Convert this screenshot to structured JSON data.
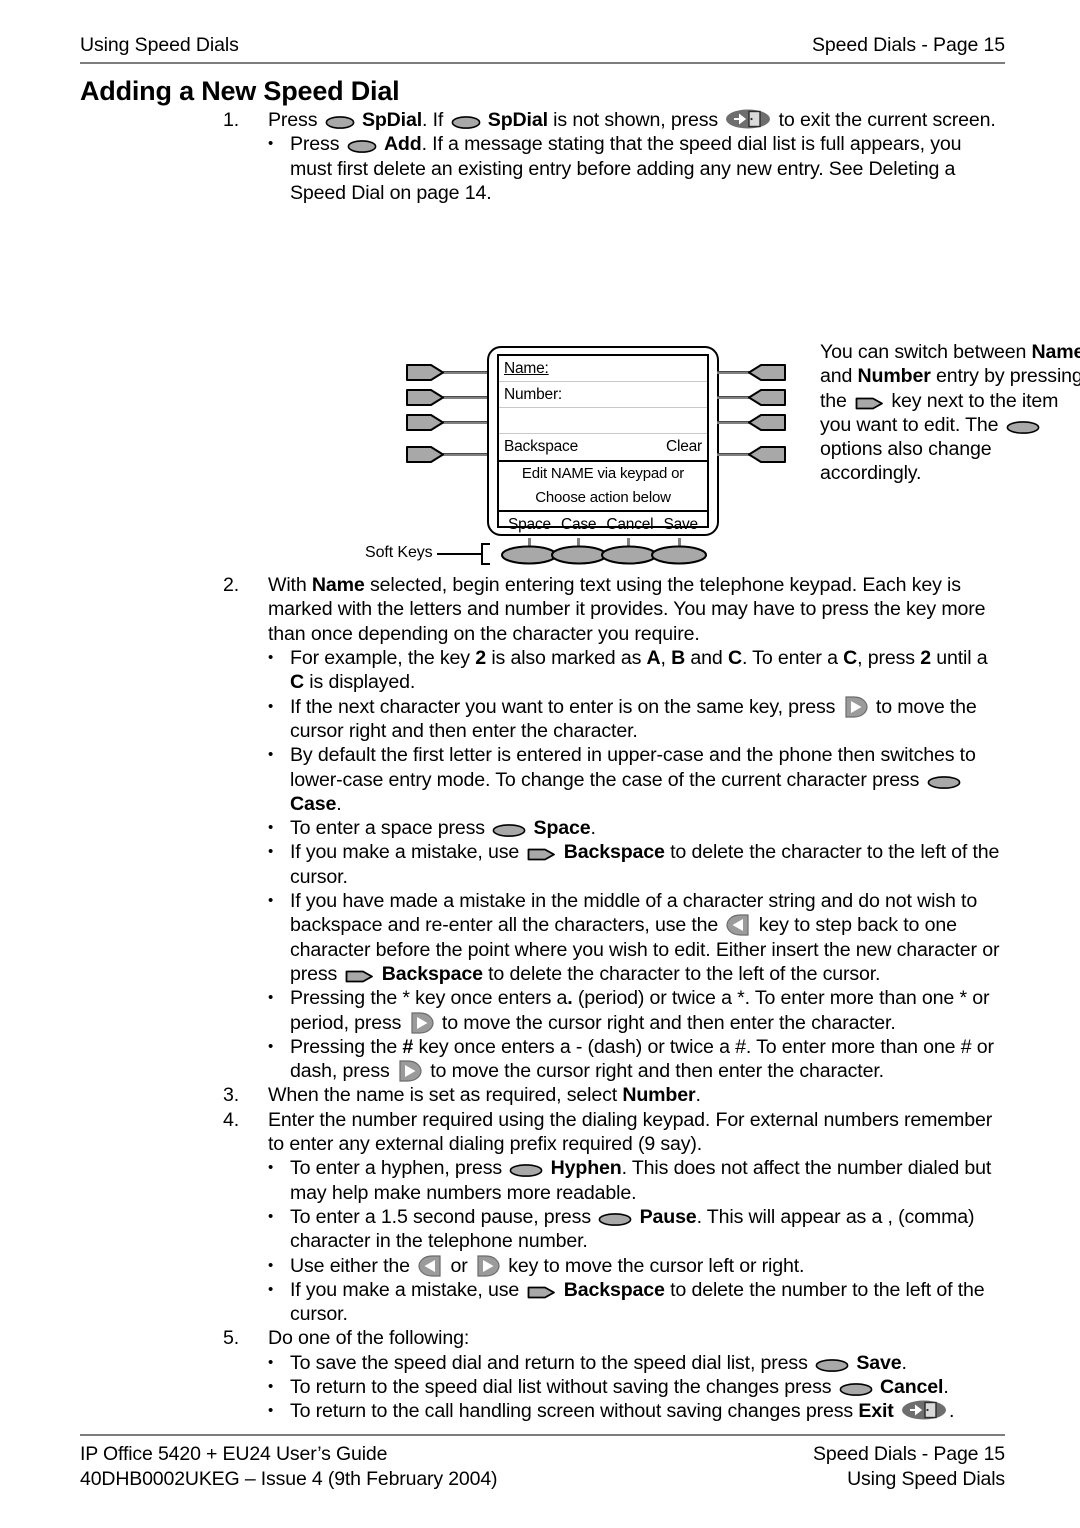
{
  "header": {
    "left": "Using Speed Dials",
    "right": "Speed Dials - Page 15"
  },
  "title": "Adding a New Speed Dial",
  "steps": {
    "s1_num": "1.",
    "s1_a": "Press",
    "s1_b": "SpDial",
    "s1_c": ". If",
    "s1_d": "SpDial",
    "s1_e": "is not shown, press",
    "s1_f": "to exit the current screen.",
    "s1_bullet_a": "Press",
    "s1_bullet_b": "Add",
    "s1_bullet_c": ". If a message stating that the speed dial list is full appears, you must first delete an existing entry before adding any new entry. See Deleting a Speed Dial on page 14.",
    "s2_num": "2.",
    "s2_a": "With",
    "s2_b": "Name",
    "s2_c": "selected, begin entering text using the telephone keypad. Each key is marked with the letters and number it provides. You may have to press the key more than once depending on the character you require.",
    "s2_b1_a": "For example, the key",
    "s2_b1_b": "2",
    "s2_b1_c": "is also marked as",
    "s2_b1_d": "A",
    "s2_b1_e": ",",
    "s2_b1_f": "B",
    "s2_b1_g": "and",
    "s2_b1_h": "C",
    "s2_b1_i": ". To enter a",
    "s2_b1_j": "C",
    "s2_b1_k": ", press",
    "s2_b1_l": "2",
    "s2_b1_m": "until a",
    "s2_b1_n": "C",
    "s2_b1_o": "is displayed.",
    "s2_b2_a": "If the next character you want to enter is on the same key, press",
    "s2_b2_b": "to move the cursor right and then enter the character.",
    "s2_b3_a": "By default the first letter is entered in upper-case and the phone then switches to lower-case entry mode. To change the case of the current character press",
    "s2_b3_b": "Case",
    "s2_b3_c": ".",
    "s2_b4_a": "To enter a space press",
    "s2_b4_b": "Space",
    "s2_b4_c": ".",
    "s2_b5_a": "If you make a mistake, use",
    "s2_b5_b": "Backspace",
    "s2_b5_c": "to delete the character to the left of the cursor.",
    "s2_b6_a": "If you have made a mistake in the middle of a character string and do not wish to backspace and re-enter all the characters, use the",
    "s2_b6_b": "key to step back to one character before the point where you wish to edit. Either insert the new character or press",
    "s2_b6_c": "Backspace",
    "s2_b6_d": "to delete the character to the left of the cursor.",
    "s2_b7_a": "Pressing the * key once enters a",
    "s2_b7_b": ".",
    "s2_b7_c": "(period) or twice a *. To enter more than one * or period, press",
    "s2_b7_d": "to move the cursor right and then enter the character.",
    "s2_b8_a": "Pressing the",
    "s2_b8_b": "#",
    "s2_b8_c": "key once enters a - (dash) or twice a #. To enter more than one # or dash, press",
    "s2_b8_d": "to move the cursor right and then enter the character.",
    "s3_num": "3.",
    "s3_a": "When the name is set as required, select",
    "s3_b": "Number",
    "s3_c": ".",
    "s4_num": "4.",
    "s4_a": "Enter the number required using the dialing keypad. For external numbers remember to enter any external dialing prefix required (9 say).",
    "s4_b1_a": "To enter a hyphen, press",
    "s4_b1_b": "Hyphen",
    "s4_b1_c": ". This does not affect the number dialed but may help make numbers more readable.",
    "s4_b2_a": "To enter a 1.5 second pause, press",
    "s4_b2_b": "Pause",
    "s4_b2_c": ". This will appear as a , (comma) character in the telephone number.",
    "s4_b3_a": "Use either the",
    "s4_b3_b": "or",
    "s4_b3_c": "key to move the cursor left or right.",
    "s4_b4_a": "If you make a mistake, use",
    "s4_b4_b": "Backspace",
    "s4_b4_c": "to delete the number to the left of the cursor.",
    "s5_num": "5.",
    "s5_a": "Do one of the following:",
    "s5_b1_a": "To save the speed dial and return to the speed dial list, press",
    "s5_b1_b": "Save",
    "s5_b1_c": ".",
    "s5_b2_a": "To return to the speed dial list without saving the changes press",
    "s5_b2_b": "Cancel",
    "s5_b2_c": ".",
    "s5_b3_a": "To return to the call handling screen without saving changes press",
    "s5_b3_b": "Exit",
    "s5_b3_c": "."
  },
  "figure": {
    "lcd": {
      "name_label": "Name:",
      "number_label": "Number:",
      "blank_row": "",
      "backspace_label": "Backspace",
      "clear_label": "Clear",
      "prompt_line1": "Edit NAME via keypad or",
      "prompt_line2": "Choose action below",
      "softkeys": [
        "Space",
        "Case",
        "Cancel",
        "Save"
      ]
    },
    "softkeys_caption": "Soft Keys"
  },
  "side_note": {
    "a": "You can switch between",
    "b": "Name",
    "c": "and",
    "d": "Number",
    "e": "entry by pressing the",
    "f": "key next to the item you want to edit. The",
    "g": "options also change accordingly."
  },
  "footer": {
    "left_line1": "IP Office 5420 + EU24 User’s Guide",
    "left_line2": "40DHB0002UKEG – Issue 4 (9th February 2004)",
    "right_line1": "Speed Dials - Page 15",
    "right_line2": "Using Speed Dials"
  },
  "colors": {
    "key_fill": "#a8a8a8",
    "key_stroke": "#000000",
    "rule": "#7d7d7d",
    "lcd_divider": "#c9c9c9"
  }
}
